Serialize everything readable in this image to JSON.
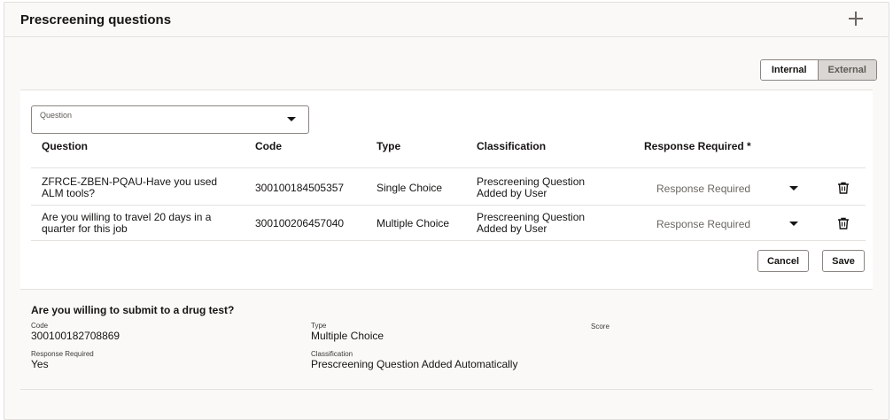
{
  "header": {
    "title": "Prescreening questions"
  },
  "toggle": {
    "internal": "Internal",
    "external": "External",
    "selected": "External"
  },
  "question_select": {
    "label": "Question"
  },
  "table": {
    "columns": [
      "Question",
      "Code",
      "Type",
      "Classification",
      "Response Required *"
    ],
    "rows": [
      {
        "question_line1": "ZFRCE-ZBEN-PQAU-Have you used",
        "question_line2": "ALM tools?",
        "code": "300100184505357",
        "type": "Single Choice",
        "classification_line1": "Prescreening Question",
        "classification_line2": "Added by User",
        "response_placeholder": "Response Required"
      },
      {
        "question_line1": "Are you willing to travel 20 days in a",
        "question_line2": "quarter for this job",
        "code": "300100206457040",
        "type": "Multiple Choice",
        "classification_line1": "Prescreening Question",
        "classification_line2": "Added by User",
        "response_placeholder": "Response Required"
      }
    ]
  },
  "actions": {
    "cancel": "Cancel",
    "save": "Save"
  },
  "detail": {
    "title": "Are you willing to submit to a drug test?",
    "code_label": "Code",
    "code_value": "300100182708869",
    "type_label": "Type",
    "type_value": "Multiple Choice",
    "score_label": "Score",
    "response_label": "Response Required",
    "response_value": "Yes",
    "classification_label": "Classification",
    "classification_value": "Prescreening Question Added Automatically"
  },
  "icons": {
    "add": "plus-icon",
    "delete": "trash-icon",
    "dropdown": "chevron-down-icon"
  },
  "colors": {
    "panel_bg": "#fbf9f8",
    "border": "#8b8581",
    "selected_segment": "#dad6d3"
  }
}
